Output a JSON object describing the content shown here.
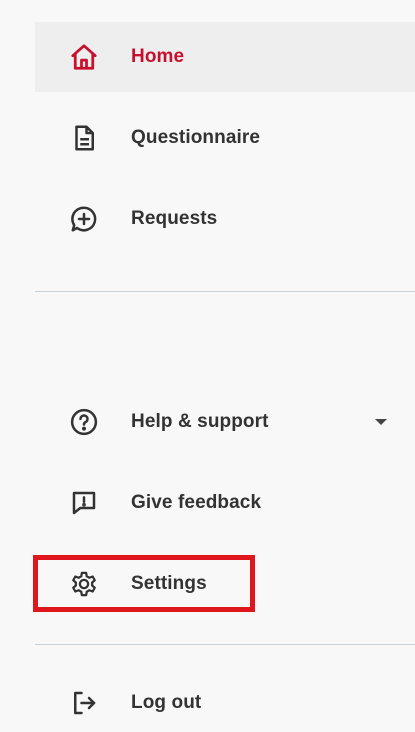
{
  "nav": {
    "items": [
      {
        "label": "Home",
        "icon": "home-icon",
        "active": true
      },
      {
        "label": "Questionnaire",
        "icon": "document-icon"
      },
      {
        "label": "Requests",
        "icon": "chat-add-icon"
      },
      {
        "label": "Help & support",
        "icon": "help-circle-icon",
        "has_dropdown": true
      },
      {
        "label": "Give feedback",
        "icon": "feedback-icon"
      },
      {
        "label": "Settings",
        "icon": "gear-icon",
        "highlighted": true
      },
      {
        "label": "Log out",
        "icon": "logout-icon"
      }
    ]
  },
  "colors": {
    "accent": "#c8102e",
    "highlight_border": "#e0161d",
    "text": "#333333",
    "active_bg": "#eeeeee",
    "divider": "#c9d0d8"
  }
}
